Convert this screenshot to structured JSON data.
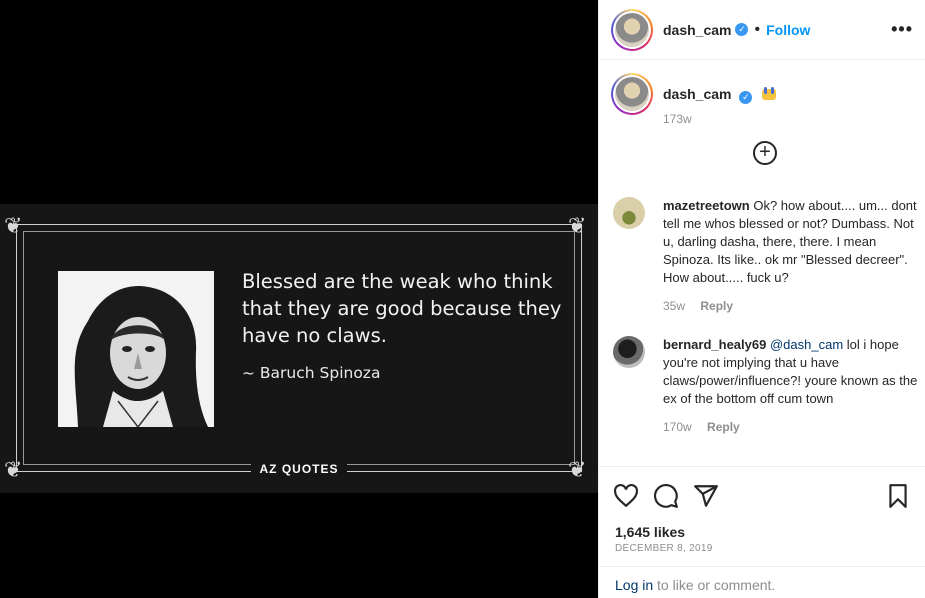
{
  "post": {
    "quote": {
      "text": "Blessed are the weak who think that they are good because they have no claws.",
      "author": "~ Baruch Spinoza",
      "brand": "AZ QUOTES"
    }
  },
  "header": {
    "username": "dash_cam",
    "separator": "•",
    "follow_label": "Follow",
    "more_label": "•••"
  },
  "caption": {
    "username": "dash_cam",
    "age": "173w"
  },
  "load_more_label": "+",
  "comments": [
    {
      "username": "mazetreetown",
      "text": "Ok? how about.... um... dont tell me whos blessed or not? Dumbass. Not u, darling dasha, there, there. I mean Spinoza. Its like.. ok mr \"Blessed decreer\". How about..... fuck u?",
      "age": "35w",
      "reply": "Reply"
    },
    {
      "username": "bernard_healy69",
      "mention": "@dash_cam",
      "text": "lol i hope you're not implying that u have claws/power/influence?! youre known as the ex of the bottom off cum town",
      "age": "170w",
      "reply": "Reply"
    }
  ],
  "stats": {
    "likes": "1,645 likes",
    "date": "DECEMBER 8, 2019"
  },
  "login": {
    "link": "Log in",
    "rest": " to like or comment."
  },
  "colors": {
    "accent": "#0095f6",
    "verified": "#3897f0",
    "muted": "#8e8e8e"
  }
}
